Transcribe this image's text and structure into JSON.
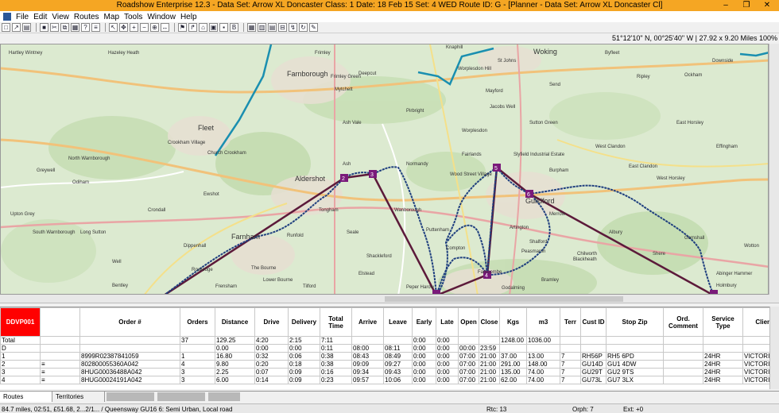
{
  "window": {
    "title": "Roadshow Enterprise 12.3 - Data Set: Arrow XL Doncaster  Class: 1  Date: 18 Feb 15  Set: 4 WED  Route ID: G - [Planner - Data Set: Arrow XL Doncaster  Cl]",
    "minimize": "–",
    "maximize": "❐",
    "close": "✕"
  },
  "menu": [
    "File",
    "Edit",
    "View",
    "Routes",
    "Map",
    "Tools",
    "Window",
    "Help"
  ],
  "coordinates": "51°12'10\" N, 00°25'40\" W  |  27.92 x 9.20 Miles  100%",
  "map": {
    "places": [
      "Hartley Wintney",
      "Hazeley Heath",
      "Fleet",
      "Crookham Village",
      "Church Crookham",
      "Farnborough",
      "Frimley",
      "Frimley Green",
      "Deepcut",
      "Mytchett",
      "Ash Vale",
      "Aldershot",
      "Ash",
      "Tongham",
      "Normandy",
      "Wood Street Village",
      "Worplesdon",
      "Pirbright",
      "Knaphill",
      "St Johns",
      "Send",
      "Guildford",
      "Slyfield Industrial Estate",
      "Burpham",
      "Merrow",
      "West Clandon",
      "East Clandon",
      "West Horsley",
      "East Horsley",
      "Effingham",
      "Shere",
      "Gomshall",
      "Abinger Hammer",
      "Albury",
      "Chilworth",
      "Shalford",
      "Godalming",
      "Farncombe",
      "Peper Harow",
      "Elstead",
      "Seale",
      "Runfold",
      "Farnham",
      "Rowledge",
      "The Bourne",
      "Dippenhall",
      "Crondall",
      "Ewshot",
      "Odiham",
      "North Warnborough",
      "Greywell",
      "Upton Grey",
      "South Warnborough",
      "Long Sutton",
      "Bentley",
      "Well",
      "Downside",
      "Ockham",
      "Wotton",
      "Ripley",
      "Worplesdon Hill",
      "Fairlands",
      "Wanborough",
      "Puttenham",
      "Compton",
      "Artington",
      "Peasmarsh",
      "Bramley",
      "Blackheath",
      "Shackleford",
      "Lower Bourne",
      "Tilford",
      "Frensham",
      "Holmbury",
      "Sutton Green",
      "Jacobs Well",
      "Mayford",
      "Woking",
      "Byfleet"
    ],
    "stop_labels": [
      "2",
      "3",
      "4",
      "5",
      "6",
      "2",
      "1"
    ]
  },
  "grid": {
    "headers": [
      "DDVP001",
      "",
      "Order #",
      "Orders",
      "Distance",
      "Drive",
      "Delivery",
      "Total Time",
      "Arrive",
      "Leave",
      "Early",
      "Late",
      "Open",
      "Close",
      "Kgs",
      "m3",
      "Terr",
      "Cust ID",
      "Stop Zip",
      "Ord. Comment",
      "Service Type",
      "Client"
    ],
    "rows": [
      [
        "Total",
        "",
        "",
        "37",
        "129.25",
        "4:20",
        "2:15",
        "7:11",
        "",
        "",
        "0:00",
        "0:00",
        "",
        "",
        "1248.00",
        "1036.00",
        "",
        "",
        "",
        "",
        "",
        ""
      ],
      [
        "D",
        "",
        "",
        "",
        "0.00",
        "0:00",
        "0:00",
        "0:11",
        "08:00",
        "08:11",
        "0:00",
        "0:00",
        "00:00",
        "23:59",
        "",
        "",
        "",
        "",
        "",
        "",
        "",
        ""
      ],
      [
        "1",
        "",
        "8999R02387841059",
        "1",
        "16.80",
        "0:32",
        "0:06",
        "0:38",
        "08:43",
        "08:49",
        "0:00",
        "0:00",
        "07:00",
        "21:00",
        "37.00",
        "13.00",
        "7",
        "RH56P",
        "RH5 6PD",
        "",
        "24HR",
        "VICTORIA PL"
      ],
      [
        "2",
        "≡",
        "802800055360A042",
        "4",
        "9.80",
        "0:20",
        "0:18",
        "0:38",
        "09:09",
        "09:27",
        "0:00",
        "0:00",
        "07:00",
        "21:00",
        "291.00",
        "148.00",
        "7",
        "GU14D",
        "GU1 4DW",
        "",
        "24HR",
        "VICTORIA PL"
      ],
      [
        "3",
        "≡",
        "8HUG00036488A042",
        "3",
        "2.25",
        "0:07",
        "0:09",
        "0:16",
        "09:34",
        "09:43",
        "0:00",
        "0:00",
        "07:00",
        "21:00",
        "135.00",
        "74.00",
        "7",
        "GU29T",
        "GU2 9TS",
        "",
        "24HR",
        "VICTORIA PL"
      ],
      [
        "4",
        "≡",
        "8HUG00024191A042",
        "3",
        "6.00",
        "0:14",
        "0:09",
        "0:23",
        "09:57",
        "10:06",
        "0:00",
        "0:00",
        "07:00",
        "21:00",
        "62.00",
        "74.00",
        "7",
        "GU73L",
        "GU7 3LX",
        "",
        "24HR",
        "VICTORIA PL"
      ]
    ]
  },
  "tabs": [
    "Routes",
    "Territories"
  ],
  "status": {
    "left": "84.7 miles, 02:51, £51.68, 2...2/1... / Queensway GU16 6: Semi Urban, Local road",
    "rtc": "Rtc: 13",
    "orph": "Orph: 7",
    "ext": "Ext: +0"
  },
  "colors": {
    "titlebar": "#f5a623",
    "route_line": "#5c1a3a",
    "route_track": "#1f3f7f",
    "other_route": "#1a8fb0",
    "stop_marker": "#7a1a7a",
    "route_id_header": "#ff0000"
  }
}
